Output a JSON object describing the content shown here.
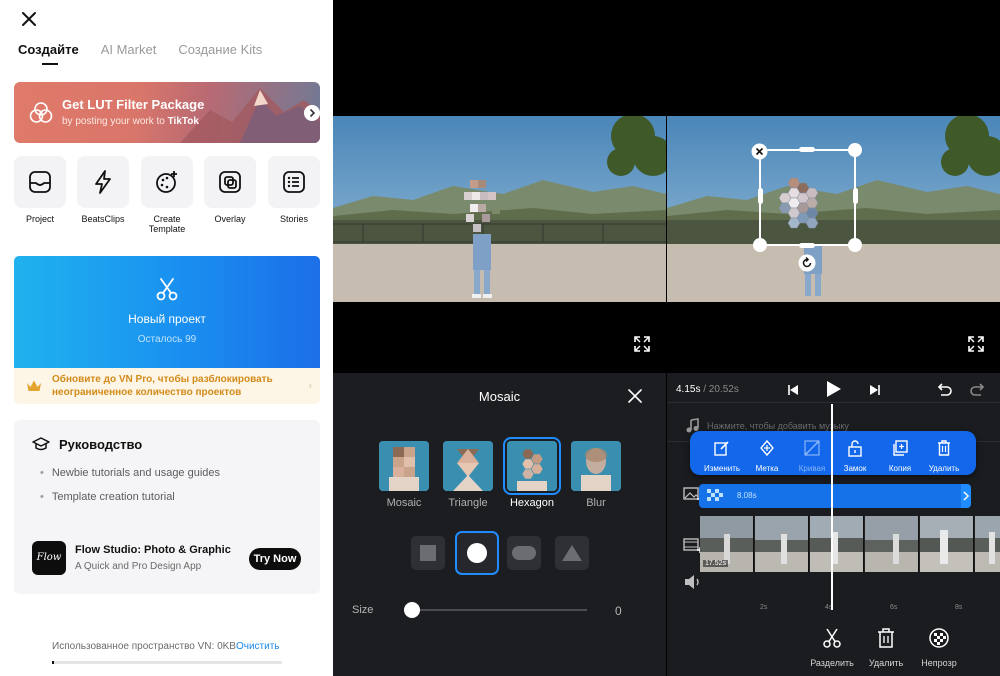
{
  "left": {
    "tabs": [
      "Создайте",
      "AI Market",
      "Создание Kits"
    ],
    "banner": {
      "title": "Get LUT Filter Package",
      "subtitle_pre": "by posting your work to ",
      "subtitle_brand": "TikTok"
    },
    "tools": [
      {
        "label": "Project",
        "icon": "project-icon"
      },
      {
        "label": "BeatsClips",
        "icon": "lightning-icon"
      },
      {
        "label": "Create\nTemplate",
        "icon": "template-icon"
      },
      {
        "label": "Overlay",
        "icon": "overlay-icon"
      },
      {
        "label": "Stories",
        "icon": "stories-icon"
      }
    ],
    "new_project": {
      "title": "Новый проект",
      "remaining": "Осталось 99"
    },
    "upgrade": {
      "text": "Обновите до VN Pro, чтобы разблокировать неограниченное количество проектов"
    },
    "guide": {
      "title": "Руководство",
      "items": [
        "Newbie tutorials and usage guides",
        "Template creation tutorial"
      ],
      "promo": {
        "logo": "Flow",
        "title": "Flow Studio: Photo & Graphic",
        "subtitle": "A Quick and Pro Design App",
        "button": "Try Now"
      }
    },
    "storage": {
      "label": "Использованное пространство VN: 0KB",
      "clear": "Очистить"
    }
  },
  "mosaic_panel": {
    "title": "Mosaic",
    "styles": [
      "Mosaic",
      "Triangle",
      "Hexagon",
      "Blur"
    ],
    "selected_style": "Hexagon",
    "shapes": [
      "square",
      "circle",
      "rounded-rect",
      "triangle"
    ],
    "selected_shape": "circle",
    "size_label": "Size",
    "size_value": "0"
  },
  "editor": {
    "time_current": "4.15s",
    "time_total": "/ 20.52s",
    "music_hint": "Нажмите, чтобы добавить музыку",
    "popup": [
      "Изменить",
      "Метка",
      "Кривая",
      "Замок",
      "Копия",
      "Удалить"
    ],
    "mosaic_duration": "8.08s",
    "clip_duration": "17.52s",
    "ruler_ticks": [
      "2s",
      "4s",
      "6s",
      "8s"
    ],
    "bottom_actions": [
      "Разделить",
      "Удалить",
      "Непрозр"
    ]
  },
  "colors": {
    "accent": "#1f8cff",
    "popup": "#1267ea",
    "track": "#1672e8",
    "upgrade_text": "#d38b1a"
  }
}
